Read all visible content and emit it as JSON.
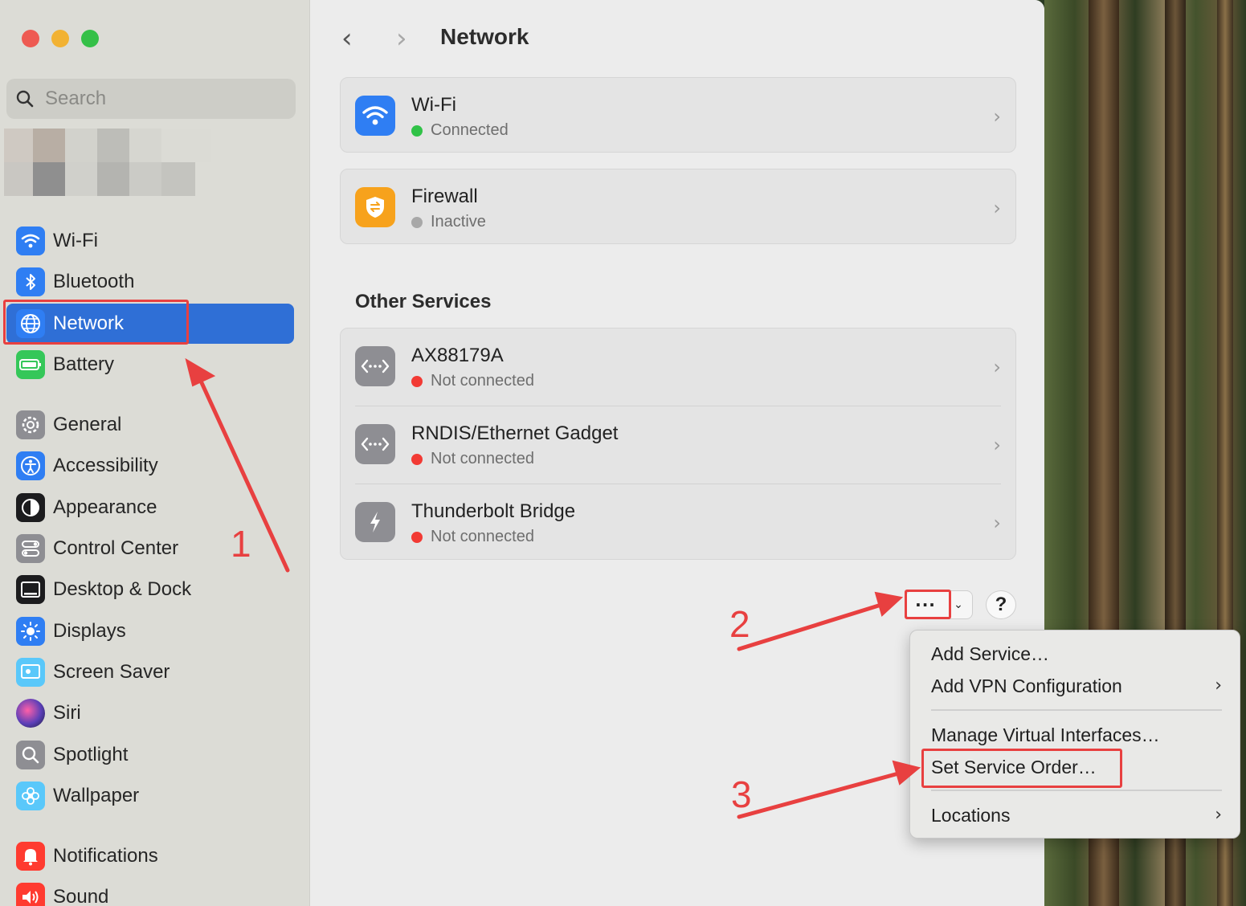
{
  "window": {
    "title": "Network"
  },
  "sidebar": {
    "search_placeholder": "Search",
    "items": [
      {
        "label": "Wi-Fi",
        "icon": "wifi-icon",
        "color": "#2f7ef3"
      },
      {
        "label": "Bluetooth",
        "icon": "bluetooth-icon",
        "color": "#2f7ef3"
      },
      {
        "label": "Network",
        "icon": "globe-icon",
        "color": "#2f7ef3",
        "selected": true
      },
      {
        "label": "Battery",
        "icon": "battery-icon",
        "color": "#35c759"
      },
      {
        "label": "General",
        "icon": "gear-icon",
        "color": "#8e8e93"
      },
      {
        "label": "Accessibility",
        "icon": "accessibility-icon",
        "color": "#2f7ef3"
      },
      {
        "label": "Appearance",
        "icon": "appearance-icon",
        "color": "#1c1c1e"
      },
      {
        "label": "Control Center",
        "icon": "control-center-icon",
        "color": "#8e8e93"
      },
      {
        "label": "Desktop & Dock",
        "icon": "dock-icon",
        "color": "#1c1c1e"
      },
      {
        "label": "Displays",
        "icon": "sun-icon",
        "color": "#2f7ef3"
      },
      {
        "label": "Screen Saver",
        "icon": "screen-saver-icon",
        "color": "#5ac8fa"
      },
      {
        "label": "Siri",
        "icon": "siri-icon",
        "color": "#5b3fb8"
      },
      {
        "label": "Spotlight",
        "icon": "magnifier-icon",
        "color": "#8e8e93"
      },
      {
        "label": "Wallpaper",
        "icon": "flower-icon",
        "color": "#5ac8fa"
      },
      {
        "label": "Notifications",
        "icon": "bell-icon",
        "color": "#ff3b30"
      },
      {
        "label": "Sound",
        "icon": "speaker-icon",
        "color": "#ff3b30"
      }
    ]
  },
  "main": {
    "title": "Network",
    "top_services": [
      {
        "name": "Wi-Fi",
        "status": "Connected",
        "status_color": "#30c247",
        "icon": "wifi-icon"
      },
      {
        "name": "Firewall",
        "status": "Inactive",
        "status_color": "#a8a8a8",
        "icon": "shield-icon"
      }
    ],
    "other_services_title": "Other Services",
    "other_services": [
      {
        "name": "AX88179A",
        "status": "Not connected",
        "status_color": "#f23a34",
        "icon": "ethernet-icon"
      },
      {
        "name": "RNDIS/Ethernet Gadget",
        "status": "Not connected",
        "status_color": "#f23a34",
        "icon": "ethernet-icon"
      },
      {
        "name": "Thunderbolt Bridge",
        "status": "Not connected",
        "status_color": "#f23a34",
        "icon": "thunderbolt-icon"
      }
    ],
    "more_button": "···",
    "help_button": "?"
  },
  "menu": {
    "items": [
      {
        "label": "Add Service…",
        "submenu": false
      },
      {
        "label": "Add VPN Configuration",
        "submenu": true
      },
      {
        "label": "Manage Virtual Interfaces…",
        "submenu": false
      },
      {
        "label": "Set Service Order…",
        "submenu": false
      },
      {
        "label": "Locations",
        "submenu": true
      }
    ]
  },
  "annotations": {
    "step1": "1",
    "step2": "2",
    "step3": "3",
    "color": "#e84040"
  }
}
